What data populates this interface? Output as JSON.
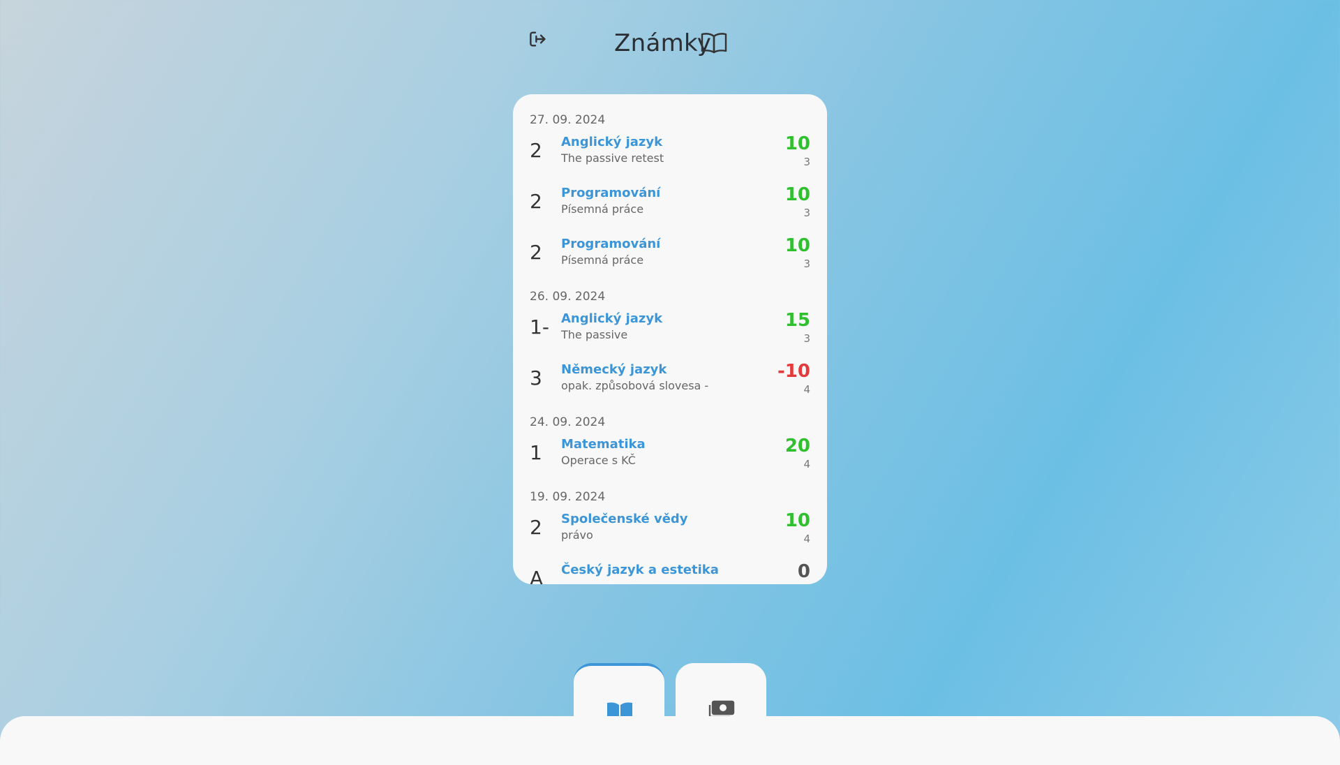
{
  "header": {
    "title": "Známky",
    "logout_icon": "logout-icon",
    "title_icon": "open-book-icon"
  },
  "colors": {
    "accent": "#3b95d6",
    "positive": "#2fbf2f",
    "negative": "#e33b3b",
    "neutral": "#555555"
  },
  "groups": [
    {
      "date": "27. 09. 2024",
      "items": [
        {
          "grade": "2",
          "subject": "Anglický jazyk",
          "desc": "The passive retest",
          "points": "10",
          "weight": "3",
          "sign": "positive"
        },
        {
          "grade": "2",
          "subject": "Programování",
          "desc": "Písemná práce",
          "points": "10",
          "weight": "3",
          "sign": "positive"
        },
        {
          "grade": "2",
          "subject": "Programování",
          "desc": "Písemná práce",
          "points": "10",
          "weight": "3",
          "sign": "positive"
        }
      ]
    },
    {
      "date": "26. 09. 2024",
      "items": [
        {
          "grade": "1-",
          "subject": "Anglický jazyk",
          "desc": "The passive",
          "points": "15",
          "weight": "3",
          "sign": "positive"
        },
        {
          "grade": "3",
          "subject": "Německý jazyk",
          "desc": "opak. způsobová slovesa -",
          "points": "-10",
          "weight": "4",
          "sign": "negative"
        }
      ]
    },
    {
      "date": "24. 09. 2024",
      "items": [
        {
          "grade": "1",
          "subject": "Matematika",
          "desc": "Operace s KČ",
          "points": "20",
          "weight": "4",
          "sign": "positive"
        }
      ]
    },
    {
      "date": "19. 09. 2024",
      "items": [
        {
          "grade": "2",
          "subject": "Společenské vědy",
          "desc": "právo",
          "points": "10",
          "weight": "4",
          "sign": "positive"
        },
        {
          "grade": "A",
          "subject": "Český jazyk a estetika",
          "desc": "",
          "points": "0",
          "weight": "",
          "sign": "neutral"
        }
      ]
    }
  ],
  "tabs": [
    {
      "icon": "open-book-icon",
      "active": true
    },
    {
      "icon": "money-icon",
      "active": false
    }
  ]
}
